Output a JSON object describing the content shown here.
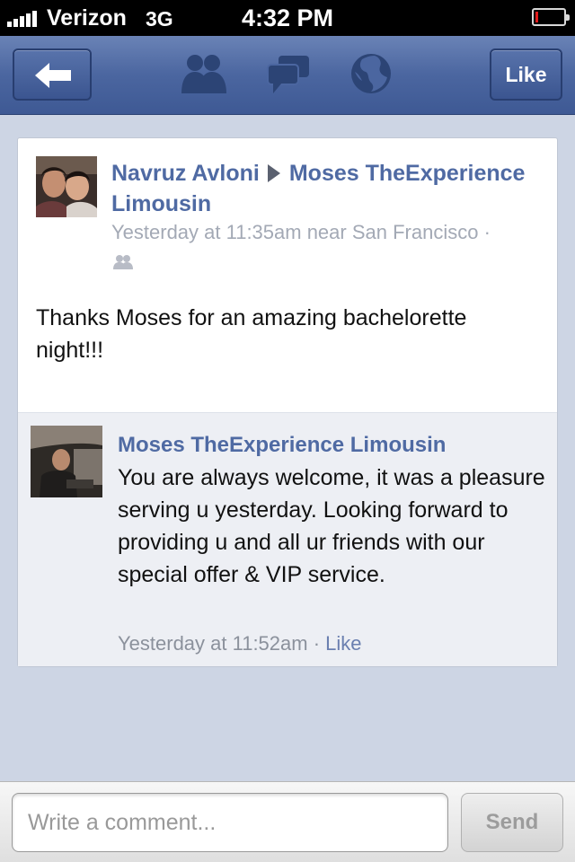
{
  "status_bar": {
    "carrier": "Verizon",
    "network": "3G",
    "time": "4:32 PM",
    "battery_level": 0.1
  },
  "nav": {
    "back_icon": "back-arrow-icon",
    "icons": [
      "friends-icon",
      "messages-icon",
      "globe-icon"
    ],
    "like_label": "Like",
    "accent_color": "#4b66a0"
  },
  "post": {
    "author": "Navruz Avloni",
    "target": "Moses TheExperience Limousin",
    "meta": "Yesterday at 11:35am near San Francisco ·",
    "audience_icon": "friends-audience-icon",
    "text": "Thanks Moses for an amazing bachelorette night!!!"
  },
  "comment": {
    "author": "Moses TheExperience Limousin",
    "text": "You are always welcome, it was a pleasure serving u yesterday. Looking forward to providing u and all ur friends with our special offer & VIP service.",
    "time": "Yesterday at 11:52am",
    "separator": " · ",
    "like_label": "Like"
  },
  "composer": {
    "placeholder": "Write a comment...",
    "send_label": "Send"
  }
}
